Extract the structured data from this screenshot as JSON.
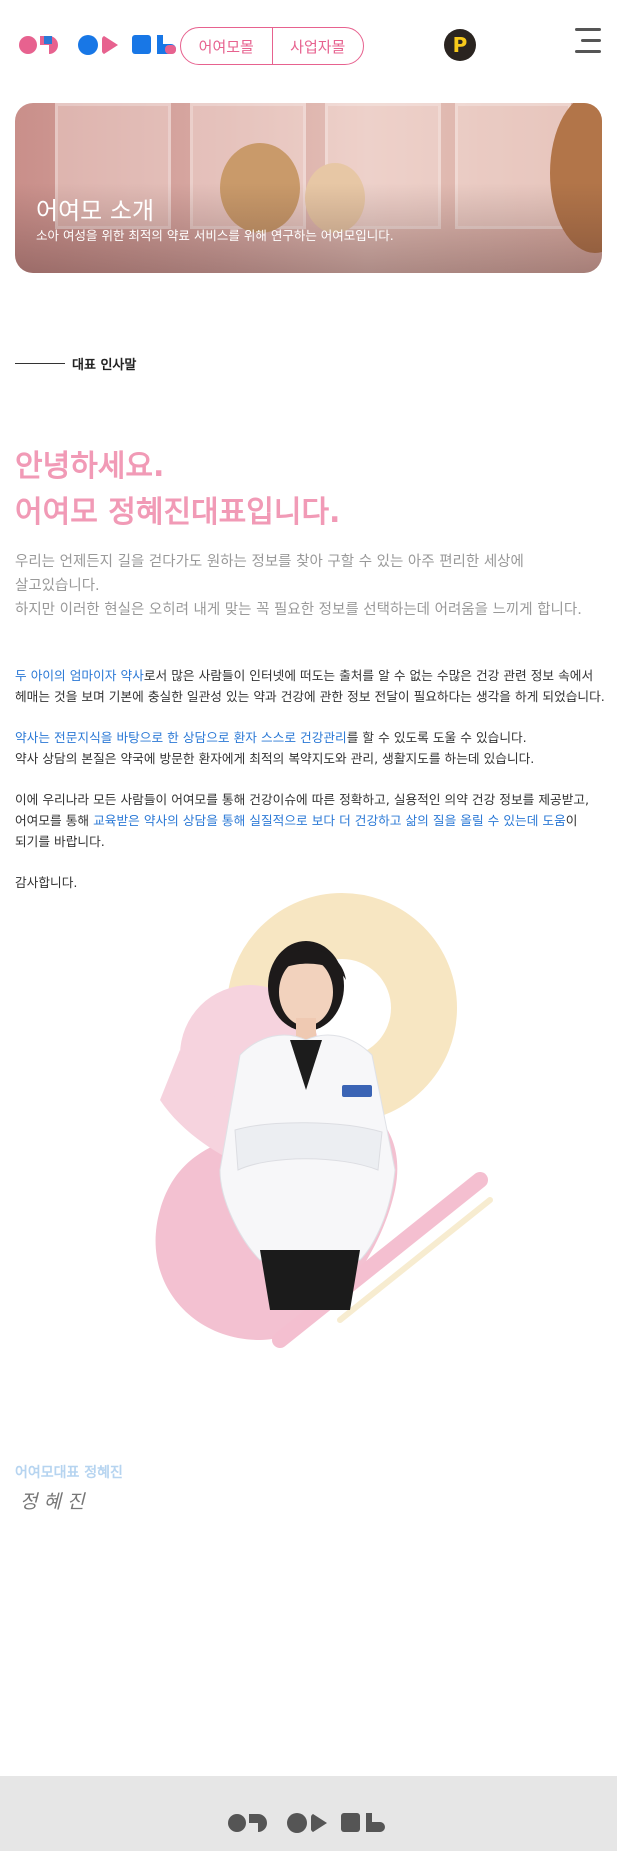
{
  "header": {
    "nav": [
      "어여모몰",
      "사업자몰"
    ],
    "point_icon": "point-coin-icon",
    "menu_icon": "hamburger-menu-icon"
  },
  "hero": {
    "title": "어여모 소개",
    "subtitle": "소아 여성을 위한 최적의 약료 서비스를 위해 연구하는 어여모입니다."
  },
  "section": {
    "label": "대표 인사말"
  },
  "greeting": {
    "line1": "안녕하세요.",
    "line2": "어여모 정혜진대표입니다."
  },
  "intro": {
    "line1": "우리는 언제든지 길을 걷다가도 원하는 정보를 찾아 구할 수 있는 아주 편리한 세상에",
    "line2": "살고있습니다.",
    "line3": "하지만 이러한 현실은 오히려 내게 맞는 꼭 필요한 정보를 선택하는데 어려움을 느끼게 합니다."
  },
  "paragraphs": {
    "p1_hl1": "두 아이의 엄마이자 약사",
    "p1_text1": "로서 많은 사람들이 인터넷에 떠도는 출처를 알 수 없는 수많은 건강 관련 정보 속에서",
    "p1_line2": "헤매는 것을 보며 기본에 충실한 일관성 있는 약과 건강에 관한 정보 전달이 필요하다는 생각을 하게 되었습니다.",
    "p2_hl1": "약사는 전문지식을 바탕으로 한 상담으로 환자 스스로 건강관리",
    "p2_text1": "를 할 수 있도록 도울 수 있습니다.",
    "p2_line2": "약사 상담의 본질은 약국에 방문한 환자에게 최적의 복약지도와 관리, 생활지도를 하는데 있습니다.",
    "p3_line1": "이에 우리나라 모든 사람들이 어여모를 통해 건강이슈에 따른 정확하고, 실용적인 의약 건강 정보를 제공받고,",
    "p3_text1": "어여모를 통해 ",
    "p3_hl1": "교육받은 약사의 상담을 통해 실질적으로 보다 더 건강하고 삶의 질을 올릴 수 있는데 도움",
    "p3_text2": "이",
    "p3_line3": "되기를 바랍니다.",
    "closing": "감사합니다."
  },
  "signature": {
    "name": "어여모대표 정혜진",
    "handwritten": "정 혜 진"
  },
  "colors": {
    "brand_pink": "#e7628f",
    "brand_blue": "#2b79d6",
    "greeting_pink": "#f19ab6",
    "footer_bg": "#e6e6e6"
  }
}
